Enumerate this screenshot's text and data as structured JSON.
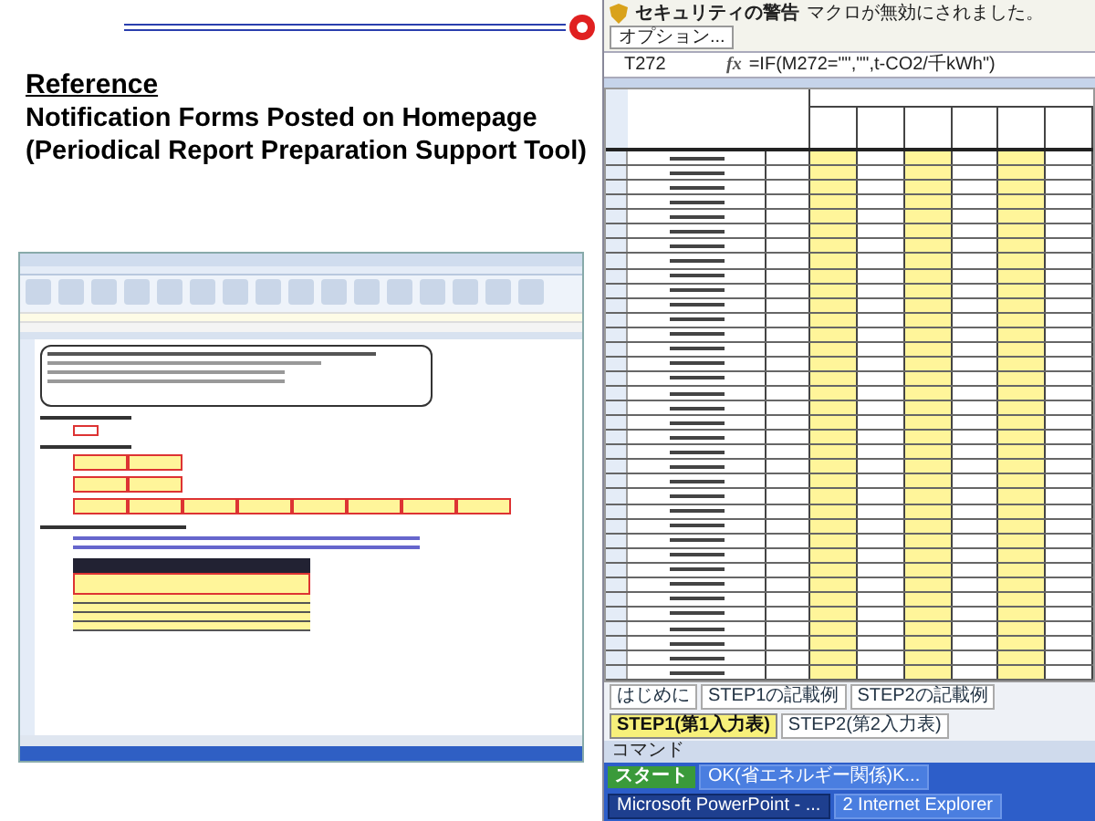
{
  "slide": {
    "heading": "Reference",
    "title_lines": [
      "Notification Forms Posted on Homepage",
      "(Periodical Report Preparation Support Tool)"
    ]
  },
  "excel_window": {
    "security_bar": {
      "title": "セキュリティの警告",
      "message": "マクロが無効にされました。",
      "button": "オプション..."
    },
    "formula_bar": {
      "cell": "T272",
      "fx": "fx",
      "formula": "=IF(M272=\"\",\"\",t-CO2/千kWh\")"
    },
    "sheet_tabs": [
      {
        "label": "はじめに",
        "selected": false
      },
      {
        "label": "STEP1の記載例",
        "selected": false
      },
      {
        "label": "STEP2の記載例",
        "selected": false
      },
      {
        "label": "STEP1(第1入力表)",
        "selected": true
      },
      {
        "label": "STEP2(第2入力表)",
        "selected": false
      }
    ],
    "status_bar": "コマンド",
    "taskbar": {
      "start": "スタート",
      "items": [
        {
          "label": "OK(省エネルギー関係)K...",
          "selected": false
        },
        {
          "label": "Microsoft PowerPoint - ...",
          "selected": true
        },
        {
          "label": "2 Internet Explorer",
          "selected": false
        }
      ]
    }
  }
}
